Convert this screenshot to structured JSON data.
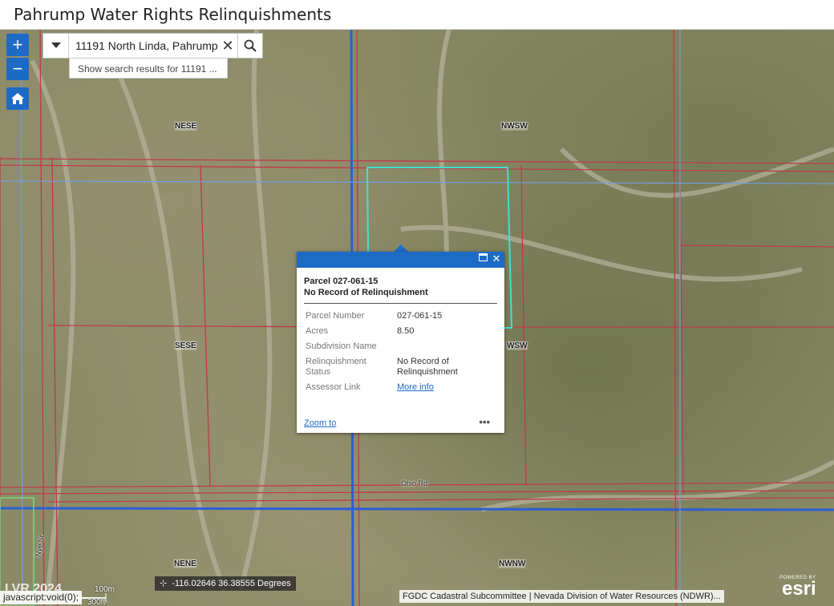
{
  "app": {
    "title": "Pahrump Water Rights Relinquishments"
  },
  "controls": {
    "zoom_in": "+",
    "zoom_out": "−"
  },
  "search": {
    "value": "11191 North Linda, Pahrump",
    "suggestion": "Show search results for 11191 ..."
  },
  "map_labels": {
    "nese": "NESE",
    "nwsw_top": "NWSW",
    "sese": "SESE",
    "nwsw_mid": "WSW",
    "nene": "NENE",
    "nwnw": "NWNW",
    "ohio_rd": "Ohio Rd",
    "nye_st": "Nye St"
  },
  "popup": {
    "title_line1": "Parcel 027-061-15",
    "title_line2": "No Record of Relinquishment",
    "rows": [
      {
        "key": "Parcel Number",
        "value": "027-061-15"
      },
      {
        "key": "Acres",
        "value": "8.50"
      },
      {
        "key": "Subdivision Name",
        "value": ""
      },
      {
        "key": "Relinquishment Status",
        "value": "No Record of Relinquishment"
      },
      {
        "key": "Assessor Link",
        "value": "More info"
      }
    ],
    "zoom_to": "Zoom to",
    "more": "•••"
  },
  "scale": {
    "metric": "100m",
    "imperial": "300ft"
  },
  "coordinates": "-116.02646 36.38555 Degrees",
  "attribution": "FGDC Cadastral Subcommittee | Nevada Division of Water Resources (NDWR)...",
  "status_bar": "javascript:void(0);",
  "watermark": "LVR 2024",
  "esri": {
    "powered_by": "POWERED BY",
    "name": "esri"
  },
  "colors": {
    "accent": "#1e6bc6",
    "parcel_line": "#c0394a",
    "section_line": "#2b5fd6",
    "selection": "#40e0d0"
  }
}
